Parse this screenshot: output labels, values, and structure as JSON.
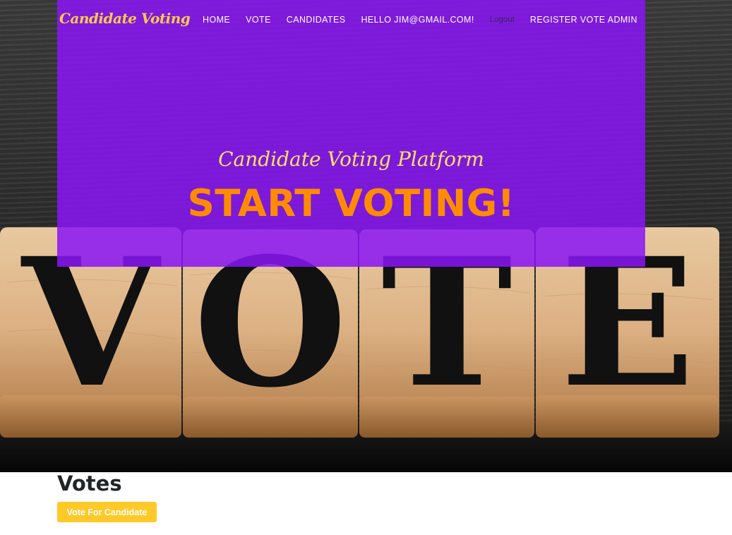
{
  "navbar": {
    "brand": "Candidate Voting",
    "links": [
      {
        "label": "HOME"
      },
      {
        "label": "VOTE"
      },
      {
        "label": "CANDIDATES"
      },
      {
        "label": "HELLO JIM@GMAIL.COM!"
      },
      {
        "label": "Logout"
      },
      {
        "label": "REGISTER VOTE ADMIN"
      }
    ]
  },
  "hero": {
    "subtitle": "Candidate Voting Platform",
    "title": "START VOTING!",
    "background_image": {
      "letters": [
        "V",
        "O",
        "T",
        "E"
      ]
    }
  },
  "votes": {
    "heading": "Votes",
    "vote_button_label": "Vote For Candidate"
  },
  "colors": {
    "overlay": "#8916f5",
    "brand": "#ffc94d",
    "subtitle": "#ffe066",
    "title": "#ff8c00",
    "button": "#ffc928"
  }
}
